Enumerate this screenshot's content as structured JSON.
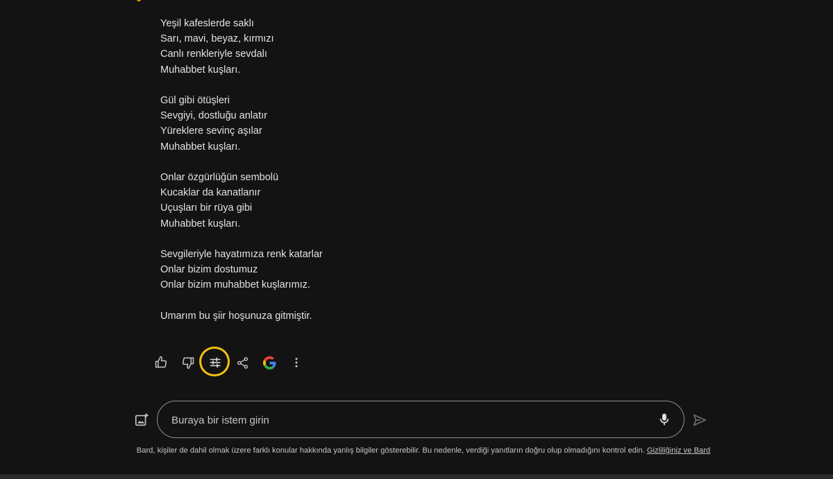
{
  "response": {
    "stanzas": [
      [
        "Yeşil kafeslerde saklı",
        "Sarı, mavi, beyaz, kırmızı",
        "Canlı renkleriyle sevdalı",
        "Muhabbet kuşları."
      ],
      [
        "Gül gibi ötüşleri",
        "Sevgiyi, dostluğu anlatır",
        "Yüreklere sevinç aşılar",
        "Muhabbet kuşları."
      ],
      [
        "Onlar özgürlüğün sembolü",
        "Kucaklar da kanatlanır",
        "Uçuşları bir rüya gibi",
        "Muhabbet kuşları."
      ],
      [
        "Sevgileriyle hayatımıza renk katarlar",
        "Onlar bizim dostumuz",
        "Onlar bizim muhabbet kuşlarımız."
      ]
    ],
    "closing": "Umarım bu şiir hoşunuza gitmiştir."
  },
  "actions": [
    {
      "name": "thumbs-up-icon",
      "label": "Good response"
    },
    {
      "name": "thumbs-down-icon",
      "label": "Bad response"
    },
    {
      "name": "modify-response-icon",
      "label": "Modify response"
    },
    {
      "name": "share-icon",
      "label": "Share"
    },
    {
      "name": "google-icon",
      "label": "Google it"
    },
    {
      "name": "more-vert-icon",
      "label": "More"
    }
  ],
  "prompt": {
    "placeholder": "Buraya bir istem girin",
    "value": ""
  },
  "disclaimer": {
    "text": "Bard, kişiler de dahil olmak üzere farklı konular hakkında yanlış bilgiler gösterebilir. Bu nedenle, verdiği yanıtların doğru olup olmadığını kontrol edin.",
    "link": "Gizliliğiniz ve Bard"
  },
  "colors": {
    "background": "#131314",
    "text": "#e3e3e3",
    "highlight_ring": "#f4c20d",
    "google_blue": "#4285f4",
    "google_red": "#ea4335",
    "google_yellow": "#fbbc05",
    "google_green": "#34a853"
  }
}
